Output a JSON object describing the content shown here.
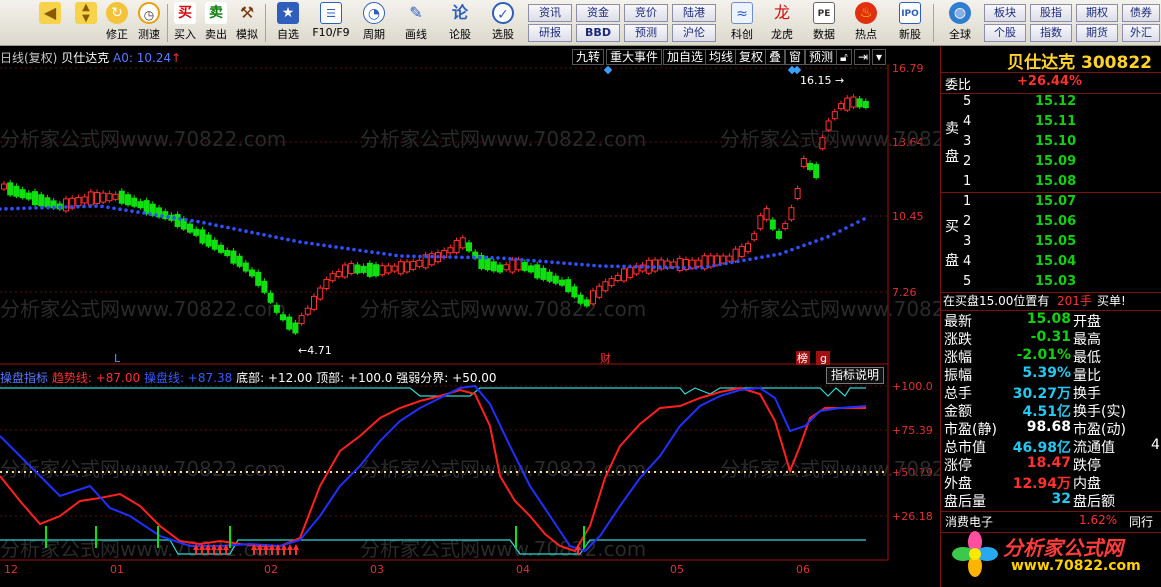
{
  "toolbar": {
    "buttons": [
      {
        "icon": "back-arrow-icon",
        "label": ""
      },
      {
        "icon": "updown-icon",
        "label": ""
      },
      {
        "icon": "edit-icon",
        "label": "修正"
      },
      {
        "icon": "clock-icon",
        "label": "测速"
      },
      {
        "icon": "buy-icon",
        "glyph": "买",
        "label": "买入"
      },
      {
        "icon": "sell-icon",
        "glyph": "卖",
        "label": "卖出"
      },
      {
        "icon": "hammer-icon",
        "label": "模拟"
      },
      {
        "icon": "star-icon",
        "label": "自选"
      },
      {
        "icon": "f10-icon",
        "label": "F10/F9"
      },
      {
        "icon": "period-icon",
        "label": "周期"
      },
      {
        "icon": "pencil-icon",
        "label": "画线"
      },
      {
        "icon": "discuss-icon",
        "label": "论股"
      },
      {
        "icon": "select-icon",
        "label": "选股"
      },
      {
        "icon": "science-icon",
        "label": "科创"
      },
      {
        "icon": "dragon-icon",
        "label": "龙虎"
      },
      {
        "icon": "pe-icon",
        "label": "数据"
      },
      {
        "icon": "hot-icon",
        "label": "热点"
      },
      {
        "icon": "ipo-icon",
        "label": "新股"
      },
      {
        "icon": "globe-icon",
        "label": "全球"
      }
    ],
    "grid_buttons": [
      [
        "资讯",
        "资金",
        "竞价",
        "陆港"
      ],
      [
        "研报",
        "BBD",
        "预测",
        "沪伦"
      ]
    ],
    "right_grid": [
      [
        "板块",
        "股指",
        "期权",
        "债券"
      ],
      [
        "个股",
        "指数",
        "期货",
        "外汇"
      ]
    ]
  },
  "chart": {
    "title": "日线(复权)",
    "stock_name": "贝仕达克",
    "ma_text": "A0: 10.24",
    "tools": [
      "九转",
      "重大事件",
      "加自选",
      "均线",
      "复权",
      "叠",
      "窗",
      "预测"
    ],
    "price_axis": [
      "16.79",
      "13.64",
      "10.45",
      "7.26"
    ],
    "high_label": "16.15",
    "low_label": "4.71",
    "markers": {
      "l": "L",
      "cai": "财",
      "bang": "榜",
      "g": "g"
    },
    "months": [
      "12",
      "01",
      "02",
      "03",
      "04",
      "05",
      "06"
    ],
    "indicator": {
      "name": "操盘指标",
      "trend": "趋势线: +87.00",
      "op": "操盘线: +87.38",
      "bottom": "底部: +12.00",
      "top": "顶部: +100.0",
      "strength": "强弱分界: +50.00",
      "btn": "指标说明",
      "axis": [
        "+100.0",
        "+75.39",
        "+50.79",
        "+26.18"
      ]
    },
    "watermark": "分析家公式网www.70822.com"
  },
  "panel": {
    "stock_name": "贝仕达克",
    "code": "300822",
    "webi_label": "委比",
    "webi_value": "+26.44%",
    "sell_label": [
      "卖",
      "盘"
    ],
    "buy_label": [
      "买",
      "盘"
    ],
    "sell": [
      {
        "lvl": "5",
        "price": "15.12"
      },
      {
        "lvl": "4",
        "price": "15.11"
      },
      {
        "lvl": "3",
        "price": "15.10"
      },
      {
        "lvl": "2",
        "price": "15.09"
      },
      {
        "lvl": "1",
        "price": "15.08"
      }
    ],
    "buy": [
      {
        "lvl": "1",
        "price": "15.07"
      },
      {
        "lvl": "2",
        "price": "15.06"
      },
      {
        "lvl": "3",
        "price": "15.05"
      },
      {
        "lvl": "4",
        "price": "15.04"
      },
      {
        "lvl": "5",
        "price": "15.03"
      }
    ],
    "notice": "在买盘15.00位置有",
    "notice_qty": "201手",
    "notice_tag": "买单!",
    "quotes": [
      {
        "k1": "最新",
        "v1": "15.08",
        "k2": "开盘",
        "v2": ""
      },
      {
        "k1": "涨跌",
        "v1": "-0.31",
        "k2": "最高",
        "v2": ""
      },
      {
        "k1": "涨幅",
        "v1": "-2.01%",
        "k2": "最低",
        "v2": ""
      },
      {
        "k1": "振幅",
        "v1": "5.39%",
        "k2": "量比",
        "v2": ""
      },
      {
        "k1": "总手",
        "v1": "30.27万",
        "k2": "换手",
        "v2": ""
      },
      {
        "k1": "金额",
        "v1": "4.51亿",
        "k2": "换手(实)",
        "v2": ""
      },
      {
        "k1": "市盈(静)",
        "v1": "98.68",
        "k2": "市盈(动)",
        "v2": ""
      },
      {
        "k1": "总市值",
        "v1": "46.98亿",
        "k2": "流通值",
        "v2": "4"
      },
      {
        "k1": "涨停",
        "v1": "18.47",
        "k2": "跌停",
        "v2": ""
      },
      {
        "k1": "外盘",
        "v1": "12.94万",
        "k2": "内盘",
        "v2": ""
      },
      {
        "k1": "盘后量",
        "v1": "32",
        "k2": "盘后额",
        "v2": ""
      }
    ],
    "sector": "消费电子",
    "sector_pct": "1.62%",
    "sector_tab": "同行",
    "logo_cn": "分析家公式网",
    "logo_url": "www.70822.com"
  }
}
